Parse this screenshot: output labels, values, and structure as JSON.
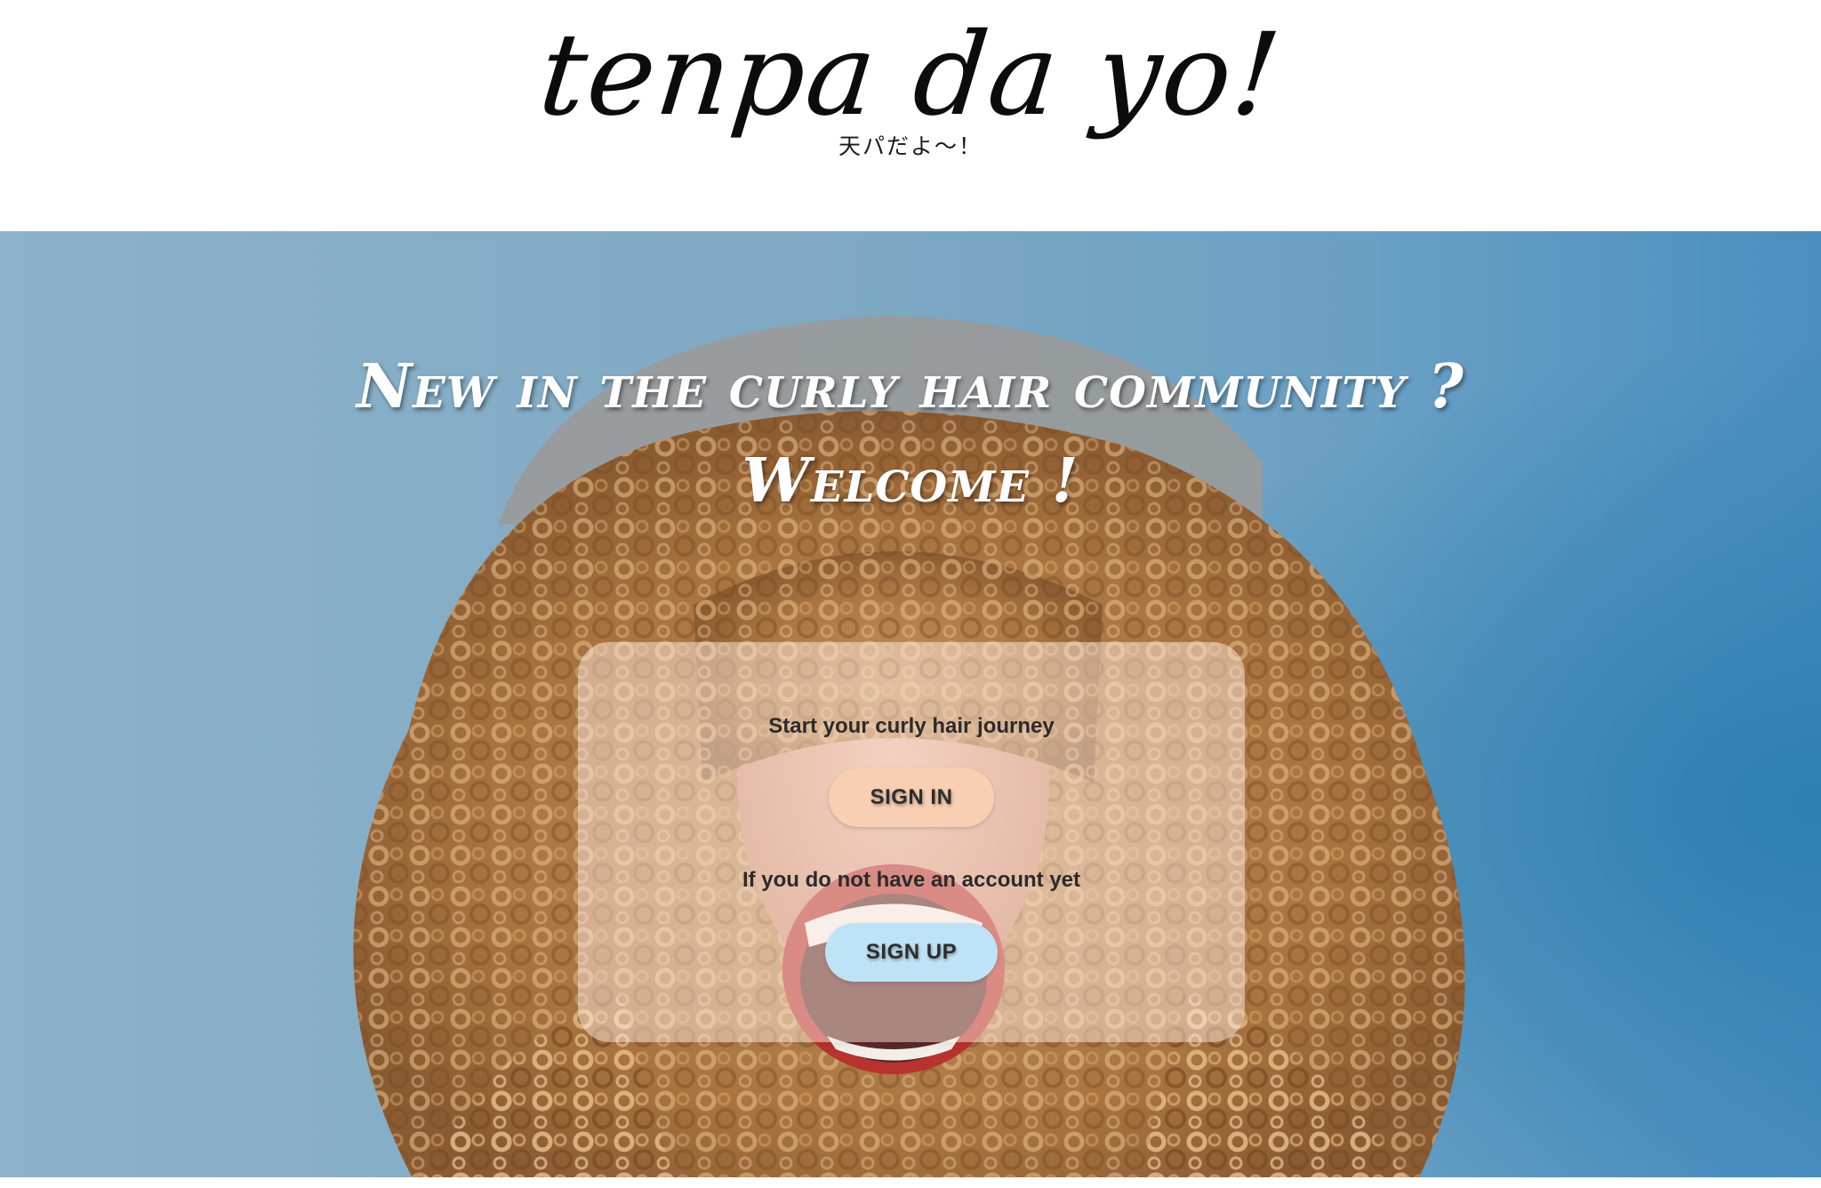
{
  "header": {
    "logo_text": "tenpa da yo!",
    "subtitle": "天パだよ～！"
  },
  "hero": {
    "heading": "New in the curly hair community ?",
    "welcome": "Welcome !",
    "photo_description": "woman-with-curly-hair-laughing"
  },
  "auth_card": {
    "start_text": "Start your curly hair journey",
    "sign_in_label": "SIGN IN",
    "no_account_text": "If you do not have an account yet",
    "sign_up_label": "SIGN UP"
  },
  "colors": {
    "sign_in_bg": "#f8cfb3",
    "sign_up_bg": "#bfe3f6",
    "hero_bg": "#7fa9c4",
    "hair": "#b07a45"
  }
}
